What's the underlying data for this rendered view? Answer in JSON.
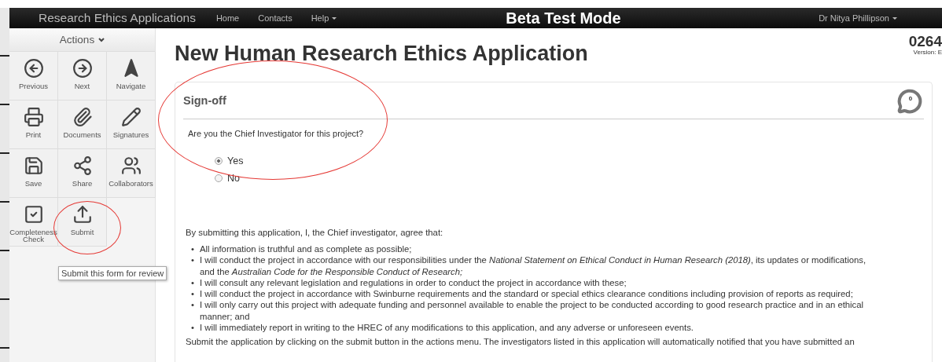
{
  "navbar": {
    "brand": "Research Ethics Applications",
    "links": [
      {
        "label": "Home",
        "dropdown": false
      },
      {
        "label": "Contacts",
        "dropdown": false
      },
      {
        "label": "Help",
        "dropdown": true
      }
    ],
    "mode": "Beta Test Mode",
    "user": "Dr Nitya Phillipson"
  },
  "sidebar": {
    "title": "Actions",
    "actions": [
      {
        "label": "Previous"
      },
      {
        "label": "Next"
      },
      {
        "label": "Navigate"
      },
      {
        "label": "Print"
      },
      {
        "label": "Documents"
      },
      {
        "label": "Signatures"
      },
      {
        "label": "Save"
      },
      {
        "label": "Share"
      },
      {
        "label": "Collaborators"
      },
      {
        "label": "Completeness Check"
      },
      {
        "label": "Submit"
      }
    ],
    "tooltip": "Submit this form for review"
  },
  "page": {
    "title": "New Human Research Ethics Application",
    "number": "0264",
    "version": "Version: E"
  },
  "panel": {
    "title": "Sign-off",
    "comments": "0",
    "bullet": "•",
    "question": "Are you the Chief Investigator for this project?",
    "options": [
      {
        "label": "Yes",
        "selected": true
      },
      {
        "label": "No",
        "selected": false
      }
    ],
    "intro": "By submitting this application, I, the Chief investigator, agree that:",
    "items": [
      "All information is truthful and as complete as possible;",
      "I will conduct the project in accordance with our responsibilities under the *National Statement on Ethical Conduct in Human Research (2018)*, its updates or modifications, and the *Australian Code for the Responsible Conduct of Research;*",
      "I will consult any relevant legislation and regulations in order to conduct the project in accordance with these;",
      "I will conduct the project in accordance with Swinburne requirements and the standard or special ethics clearance conditions including provision of reports as required;",
      "I will only carry out this project with adequate funding and personnel available to enable the project to be conducted according to good research practice and in an ethical manner; and",
      "I will immediately report in writing to the HREC of any modifications to this application, and any adverse or unforeseen events."
    ],
    "footer": "Submit the application by clicking on the submit button in the actions menu. The investigators listed in this application will automatically notified that you have submitted an"
  }
}
